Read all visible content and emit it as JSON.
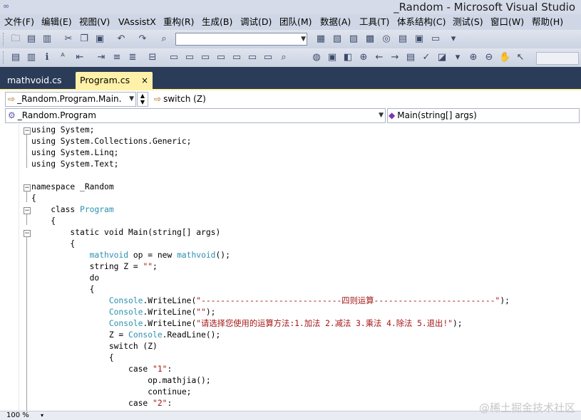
{
  "window": {
    "title": "_Random - Microsoft Visual Studio"
  },
  "menu": [
    "文件(F)",
    "编辑(E)",
    "视图(V)",
    "VAssistX",
    "重构(R)",
    "生成(B)",
    "调试(D)",
    "团队(M)",
    "数据(A)",
    "工具(T)",
    "体系结构(C)",
    "测试(S)",
    "窗口(W)",
    "帮助(H)"
  ],
  "tabs": [
    {
      "label": "mathvoid.cs",
      "active": false
    },
    {
      "label": "Program.cs",
      "active": true,
      "close": "×"
    }
  ],
  "nav": {
    "member_combo": "_Random.Program.Main.",
    "member_search": "switch (Z)",
    "type_combo": "_Random.Program",
    "method_combo": "Main(string[] args)"
  },
  "code": [
    "using System;",
    "using System.Collections.Generic;",
    "using System.Linq;",
    "using System.Text;",
    "",
    "namespace _Random",
    "{",
    "    class Program",
    "    {",
    "        static void Main(string[] args)",
    "        {",
    "            mathvoid op = new mathvoid();",
    "            string Z = \"\";",
    "            do",
    "            {",
    "                Console.WriteLine(\"-----------------------------四则运算-------------------------\");",
    "                Console.WriteLine(\"\");",
    "                Console.WriteLine(\"请选择您使用的运算方法:1.加法 2.减法 3.乘法 4.除法 5.退出!\");",
    "                Z = Console.ReadLine();",
    "                switch (Z)",
    "                {",
    "                    case \"1\":",
    "                        op.mathjia();",
    "                        continue;",
    "                    case \"2\":"
  ],
  "status": {
    "zoom": "100 %",
    "zoom_arrow": "▾"
  },
  "watermark": "@稀土掘金技术社区",
  "colors": {
    "tab_active": "#fff2a8",
    "tab_strip": "#2b3c59",
    "type_name": "#2b91af",
    "string": "#a31515"
  }
}
